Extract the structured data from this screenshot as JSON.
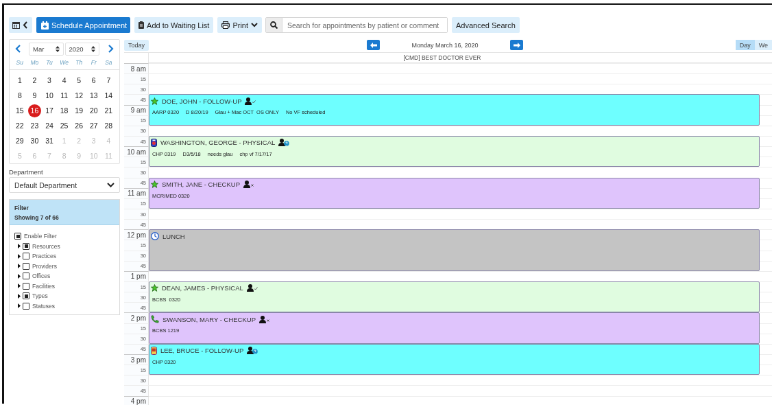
{
  "toolbar": {
    "schedule_button": "Schedule Appointment",
    "waiting_list_button": "Add to Waiting List",
    "print_button": "Print",
    "search": {
      "placeholder": "Search for appointments by patient or comment"
    },
    "advanced_search_button": "Advanced Search"
  },
  "mini_calendar": {
    "month": "Mar",
    "year": "2020",
    "weekdays": [
      "Su",
      "Mo",
      "Tu",
      "We",
      "Th",
      "Fr",
      "Sa"
    ],
    "weeks": [
      [
        {
          "day": "1",
          "muted": false,
          "selected": false
        },
        {
          "day": "2",
          "muted": false,
          "selected": false
        },
        {
          "day": "3",
          "muted": false,
          "selected": false
        },
        {
          "day": "4",
          "muted": false,
          "selected": false
        },
        {
          "day": "5",
          "muted": false,
          "selected": false
        },
        {
          "day": "6",
          "muted": false,
          "selected": false
        },
        {
          "day": "7",
          "muted": false,
          "selected": false
        }
      ],
      [
        {
          "day": "8",
          "muted": false,
          "selected": false
        },
        {
          "day": "9",
          "muted": false,
          "selected": false
        },
        {
          "day": "10",
          "muted": false,
          "selected": false
        },
        {
          "day": "11",
          "muted": false,
          "selected": false
        },
        {
          "day": "12",
          "muted": false,
          "selected": false
        },
        {
          "day": "13",
          "muted": false,
          "selected": false
        },
        {
          "day": "14",
          "muted": false,
          "selected": false
        }
      ],
      [
        {
          "day": "15",
          "muted": false,
          "selected": false
        },
        {
          "day": "16",
          "muted": false,
          "selected": true
        },
        {
          "day": "17",
          "muted": false,
          "selected": false
        },
        {
          "day": "18",
          "muted": false,
          "selected": false
        },
        {
          "day": "19",
          "muted": false,
          "selected": false
        },
        {
          "day": "20",
          "muted": false,
          "selected": false
        },
        {
          "day": "21",
          "muted": false,
          "selected": false
        }
      ],
      [
        {
          "day": "22",
          "muted": false,
          "selected": false
        },
        {
          "day": "23",
          "muted": false,
          "selected": false
        },
        {
          "day": "24",
          "muted": false,
          "selected": false
        },
        {
          "day": "25",
          "muted": false,
          "selected": false
        },
        {
          "day": "26",
          "muted": false,
          "selected": false
        },
        {
          "day": "27",
          "muted": false,
          "selected": false
        },
        {
          "day": "28",
          "muted": false,
          "selected": false
        }
      ],
      [
        {
          "day": "29",
          "muted": false,
          "selected": false
        },
        {
          "day": "30",
          "muted": false,
          "selected": false
        },
        {
          "day": "31",
          "muted": false,
          "selected": false
        },
        {
          "day": "1",
          "muted": true,
          "selected": false
        },
        {
          "day": "2",
          "muted": true,
          "selected": false
        },
        {
          "day": "3",
          "muted": true,
          "selected": false
        },
        {
          "day": "4",
          "muted": true,
          "selected": false
        }
      ],
      [
        {
          "day": "5",
          "muted": true,
          "selected": false
        },
        {
          "day": "6",
          "muted": true,
          "selected": false
        },
        {
          "day": "7",
          "muted": true,
          "selected": false
        },
        {
          "day": "8",
          "muted": true,
          "selected": false
        },
        {
          "day": "9",
          "muted": true,
          "selected": false
        },
        {
          "day": "10",
          "muted": true,
          "selected": false
        },
        {
          "day": "11",
          "muted": true,
          "selected": false
        }
      ]
    ]
  },
  "department": {
    "label": "Department",
    "value": "Default Department"
  },
  "filter": {
    "title": "Filter",
    "summary": "Showing 7 of 66",
    "enable": {
      "label": "Enable Filter",
      "checked": true
    },
    "items": [
      {
        "label": "Resources",
        "checked": true
      },
      {
        "label": "Practices",
        "checked": false
      },
      {
        "label": "Providers",
        "checked": false
      },
      {
        "label": "Offices",
        "checked": false
      },
      {
        "label": "Facilities",
        "checked": false
      },
      {
        "label": "Types",
        "checked": true
      },
      {
        "label": "Statuses",
        "checked": false
      }
    ]
  },
  "day_view": {
    "today_button": "Today",
    "date": "Monday March 16, 2020",
    "views": [
      {
        "label": "Day",
        "selected": true
      },
      {
        "label": "We",
        "selected": false
      }
    ],
    "resource": "[CMD] BEST DOCTOR EVER",
    "rows": [
      {
        "kind": "hour",
        "label": "8 am"
      },
      {
        "kind": "quarter",
        "label": "15"
      },
      {
        "kind": "quarter",
        "label": "30"
      },
      {
        "kind": "booking",
        "appointment": {
          "title": "DOE, JOHN - FOLLOW-UP",
          "kind": "star",
          "status_mark": {
            "kind": "check"
          },
          "color": "#6effff",
          "notes": [
            "AARP 0320",
            "D 8/20/19",
            "Glau + Mac OCT  OS ONLY",
            "No VF scheduled"
          ]
        },
        "slots": [
          {
            "kind": "quarter",
            "label": "45"
          },
          {
            "kind": "hour",
            "label": "9 am"
          },
          {
            "kind": "quarter",
            "label": "15"
          }
        ]
      },
      {
        "kind": "quarter",
        "label": "30"
      },
      {
        "kind": "booking",
        "appointment": {
          "title": "WASHINGTON, GEORGE - PHYSICAL",
          "kind": "badge",
          "status_mark": {
            "kind": "question"
          },
          "color": "#e0fce0",
          "notes": [
            "CHP 0319",
            "D3/5/18",
            "needs glau",
            "chp vf 7/17/17"
          ]
        },
        "slots": [
          {
            "kind": "quarter",
            "label": "45"
          },
          {
            "kind": "hour",
            "label": "10 am"
          },
          {
            "kind": "quarter",
            "label": "15"
          }
        ]
      },
      {
        "kind": "quarter",
        "label": "30"
      },
      {
        "kind": "booking",
        "appointment": {
          "title": "SMITH, JANE - CHECKUP",
          "kind": "star",
          "status_mark": {
            "kind": "cross"
          },
          "color": "#dfc4fc",
          "notes": [
            "MCR/MED 0320"
          ]
        },
        "slots": [
          {
            "kind": "quarter",
            "label": "45"
          },
          {
            "kind": "hour",
            "label": "11 am"
          },
          {
            "kind": "quarter",
            "label": "15"
          }
        ]
      },
      {
        "kind": "quarter",
        "label": "30"
      },
      {
        "kind": "quarter",
        "label": "45"
      },
      {
        "kind": "booking",
        "appointment": {
          "title": "LUNCH",
          "kind": "clock",
          "color": "#c4c4c4"
        },
        "slots": [
          {
            "kind": "hour",
            "label": "12 pm"
          },
          {
            "kind": "quarter",
            "label": "15"
          },
          {
            "kind": "quarter",
            "label": "30"
          },
          {
            "kind": "quarter",
            "label": "45"
          }
        ]
      },
      {
        "kind": "hour",
        "label": "1 pm"
      },
      {
        "kind": "booking",
        "appointment": {
          "title": "DEAN, JAMES - PHYSICAL",
          "kind": "star",
          "status_mark": {
            "kind": "check"
          },
          "color": "#e0fce0",
          "notes": [
            "BCBS  0320"
          ]
        },
        "slots": [
          {
            "kind": "quarter",
            "label": "15"
          },
          {
            "kind": "quarter",
            "label": "30"
          },
          {
            "kind": "quarter",
            "label": "45"
          }
        ]
      },
      {
        "kind": "booking",
        "appointment": {
          "title": "SWANSON, MARY - CHECKUP",
          "kind": "phone",
          "status_mark": {
            "kind": "cross"
          },
          "color": "#dfc4fc",
          "notes": [
            "BCBS 1219"
          ]
        },
        "slots": [
          {
            "kind": "hour",
            "label": "2 pm"
          },
          {
            "kind": "quarter",
            "label": "15"
          },
          {
            "kind": "quarter",
            "label": "30"
          }
        ]
      },
      {
        "kind": "booking",
        "appointment": {
          "title": "LEE, BRUCE - FOLLOW-UP",
          "kind": "card",
          "status_mark": {
            "kind": "question"
          },
          "color": "#6effff",
          "notes": [
            "CHP 0320"
          ]
        },
        "slots": [
          {
            "kind": "quarter",
            "label": "45"
          },
          {
            "kind": "hour",
            "label": "3 pm"
          },
          {
            "kind": "quarter",
            "label": "15"
          }
        ]
      },
      {
        "kind": "quarter",
        "label": "30"
      },
      {
        "kind": "quarter",
        "label": "45"
      },
      {
        "kind": "hour",
        "label": "4 pm"
      }
    ]
  }
}
